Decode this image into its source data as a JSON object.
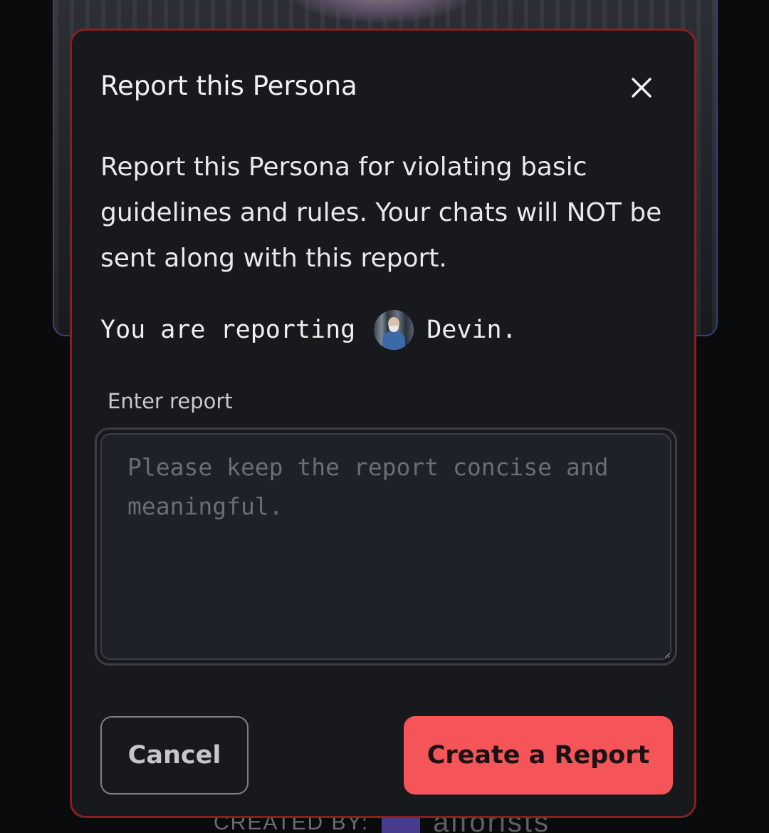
{
  "background": {
    "footer_label": "CREATED BY:",
    "footer_creator": "aiforists"
  },
  "modal": {
    "title": "Report this Persona",
    "close_icon": "close-icon",
    "description": "Report this Persona for violating basic guidelines and rules. Your chats will NOT be sent along with this report.",
    "reporting_prefix": "You are reporting",
    "persona_name": "Devin.",
    "field_label": "Enter report",
    "input_value": "",
    "input_placeholder": "Please keep the report concise and meaningful.",
    "cancel_label": "Cancel",
    "submit_label": "Create a Report"
  },
  "colors": {
    "modal_bg": "#17191d",
    "modal_border": "#8a1f22",
    "accent": "#f55458",
    "text": "#f1f1f2",
    "placeholder": "#6a6d72"
  }
}
